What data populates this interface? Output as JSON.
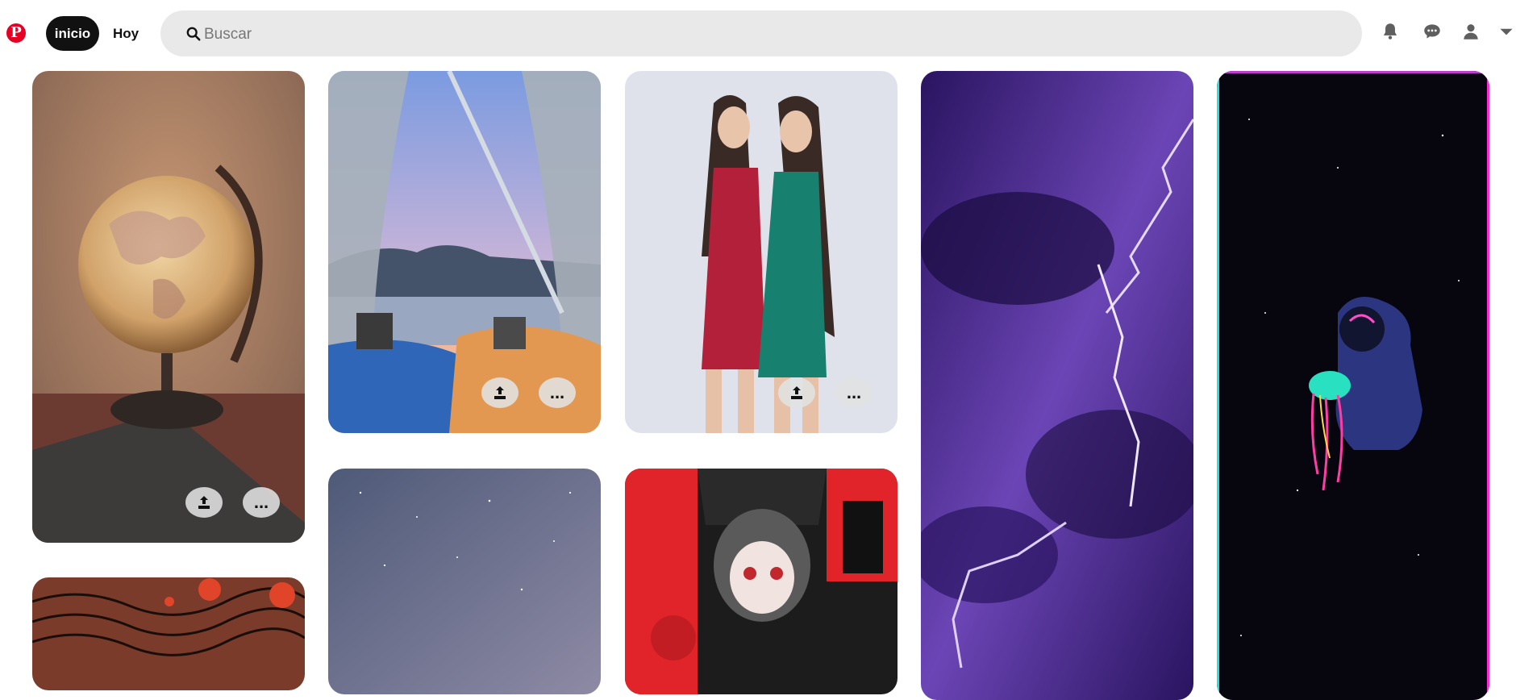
{
  "header": {
    "logo": "P",
    "nav": [
      {
        "label": "inicio",
        "active": true
      },
      {
        "label": "Hoy",
        "active": false
      }
    ],
    "search": {
      "placeholder": "Buscar",
      "value": ""
    },
    "icons": [
      "bell-icon",
      "chat-icon",
      "user-icon",
      "chevron-down-icon"
    ]
  },
  "pins": {
    "more_label": "...",
    "save_icon": "upload-icon",
    "items": [
      {
        "name": "pin-globe",
        "subject": "globe lamp on book",
        "colors": [
          "#c99a6b",
          "#6b3e31"
        ]
      },
      {
        "name": "pin-tent-view",
        "subject": "view from tent over lake",
        "colors": [
          "#8ea6d6",
          "#f0a55c"
        ]
      },
      {
        "name": "pin-two-girls",
        "subject": "two women in dresses",
        "colors": [
          "#d8dbe6",
          "#b0243a"
        ]
      },
      {
        "name": "pin-lightning",
        "subject": "purple lightning storm",
        "colors": [
          "#4a2a8a",
          "#1b0c3c"
        ]
      },
      {
        "name": "pin-astronaut",
        "subject": "astronaut holding jellyfish",
        "colors": [
          "#070612",
          "#2d3a8a"
        ]
      },
      {
        "name": "pin-red-waves",
        "subject": "red flowers and wave lines",
        "colors": [
          "#7a3b2a",
          "#d94a2a"
        ]
      },
      {
        "name": "pin-starry-sky",
        "subject": "milky way sky",
        "colors": [
          "#5b6b8a",
          "#8f8aa0"
        ]
      },
      {
        "name": "pin-anime",
        "subject": "anime girl poster",
        "colors": [
          "#e0242a",
          "#222222"
        ]
      }
    ]
  }
}
